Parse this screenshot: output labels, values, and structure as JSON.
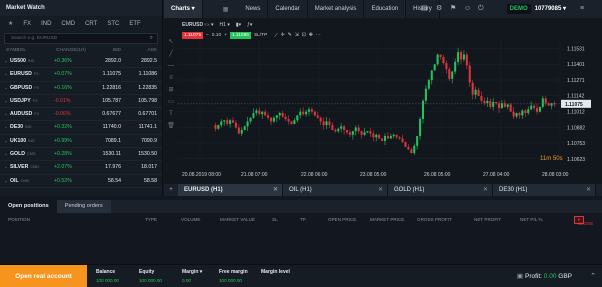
{
  "market_watch": {
    "title": "Market Watch",
    "tabs": [
      "FX",
      "IND",
      "CMD",
      "CRT",
      "STC",
      "ETF"
    ],
    "search_placeholder": "Search e.g. EURUSD",
    "columns": [
      "SYMBOL",
      "CHANGE(1H)",
      "BID",
      "ASK"
    ],
    "rows": [
      {
        "symbol": "US500",
        "type": "IND",
        "change": "+0.36%",
        "dir": "pos",
        "bid": "2892.0",
        "ask": "2892.5"
      },
      {
        "symbol": "EURUSD",
        "type": "FX",
        "change": "+0.07%",
        "dir": "pos",
        "bid": "1.11075",
        "ask": "1.11086"
      },
      {
        "symbol": "GBPUSD",
        "type": "FX",
        "change": "+0.16%",
        "dir": "pos",
        "bid": "1.22816",
        "ask": "1.22835"
      },
      {
        "symbol": "USDJPY",
        "type": "FX",
        "change": "-0.01%",
        "dir": "neg",
        "bid": "105.787",
        "ask": "105.798"
      },
      {
        "symbol": "AUDUSD",
        "type": "FX",
        "change": "-0.06%",
        "dir": "neg",
        "bid": "0.67677",
        "ask": "0.67701"
      },
      {
        "symbol": "DE30",
        "type": "IND",
        "change": "+0.32%",
        "dir": "pos",
        "bid": "11740.0",
        "ask": "11741.1"
      },
      {
        "symbol": "UK100",
        "type": "IND",
        "change": "+0.99%",
        "dir": "pos",
        "bid": "7089.1",
        "ask": "7090.9"
      },
      {
        "symbol": "GOLD",
        "type": "CMD",
        "change": "+0.28%",
        "dir": "pos",
        "bid": "1530.11",
        "ask": "1530.50"
      },
      {
        "symbol": "SILVER",
        "type": "CMD",
        "change": "+2.07%",
        "dir": "pos",
        "bid": "17.976",
        "ask": "18.017"
      },
      {
        "symbol": "OIL",
        "type": "CMD",
        "change": "+0.52%",
        "dir": "pos",
        "bid": "58.54",
        "ask": "58.58"
      }
    ]
  },
  "top_nav": {
    "charts_label": "Charts",
    "tabs": [
      "News",
      "Calendar",
      "Market analysis",
      "Education",
      "History"
    ],
    "account_badge": "DEMO",
    "account_id": "10779085"
  },
  "chart_toolbar": {
    "symbol": "EURUSD",
    "symbol_type": "FX",
    "timeframe": "H1",
    "sell_price": "1.11075",
    "volume": "0.10",
    "buy_price": "1.11086",
    "sl_tp": "SL/TP"
  },
  "chart_data": {
    "type": "candlestick",
    "symbol": "EURUSD",
    "timeframe": "H1",
    "current_price": "1.11075",
    "countdown": "11m 50s",
    "ylim": [
      1.1058,
      1.116
    ],
    "y_ticks": [
      "1.11531",
      "1.11401",
      "1.11271",
      "1.11142",
      "1.11012",
      "1.10882",
      "1.10753",
      "1.10623"
    ],
    "x_ticks": [
      "20.08.2019 08:00",
      "21.08 07:00",
      "22.08 06:00",
      "23.08 05:00",
      "26.08 05:00",
      "27.08 04:00",
      "28.08 03:00"
    ],
    "path": [
      1.109,
      1.1087,
      1.109,
      1.1093,
      1.1094,
      1.1091,
      1.1094,
      1.1092,
      1.1088,
      1.1083,
      1.1086,
      1.1089,
      1.1093,
      1.1096,
      1.11,
      1.1102,
      1.1099,
      1.1101,
      1.1098,
      1.1096,
      1.1093,
      1.1096,
      1.1098,
      1.11,
      1.1097,
      1.1095,
      1.1093,
      1.1091,
      1.1094,
      1.1098,
      1.1101,
      1.1099,
      1.1101,
      1.1103,
      1.1101,
      1.1098,
      1.1096,
      1.1093,
      1.109,
      1.1093,
      1.109,
      1.1086,
      1.1085,
      1.1087,
      1.1089,
      1.1086,
      1.1084,
      1.1082,
      1.1085,
      1.1088,
      1.1085,
      1.1082,
      1.1084,
      1.1085,
      1.1083,
      1.108,
      1.1082,
      1.1079,
      1.1077,
      1.1081,
      1.1079,
      1.1081,
      1.1082,
      1.108,
      1.1079,
      1.1076,
      1.1072,
      1.107,
      1.1067,
      1.1073,
      1.1081,
      1.1095,
      1.111,
      1.112,
      1.1127,
      1.1135,
      1.114,
      1.1148,
      1.1146,
      1.1141,
      1.1136,
      1.1128,
      1.1134,
      1.1142,
      1.115,
      1.1144,
      1.1148,
      1.1139,
      1.1125,
      1.1115,
      1.1119,
      1.1114,
      1.111,
      1.1108,
      1.111,
      1.1105,
      1.1109,
      1.1108,
      1.1104,
      1.1108,
      1.1105,
      1.1107,
      1.1101,
      1.1097,
      1.11,
      1.1098,
      1.1102,
      1.11,
      1.1103,
      1.1106,
      1.1104,
      1.1101,
      1.1105,
      1.1112,
      1.1108,
      1.1106,
      1.1108,
      1.1107
    ]
  },
  "chart_tabs": [
    {
      "label": "EURUSD (H1)",
      "active": true
    },
    {
      "label": "OIL (H1)",
      "active": false
    },
    {
      "label": "GOLD (H1)",
      "active": false
    },
    {
      "label": "DE30 (H1)",
      "active": false
    }
  ],
  "positions": {
    "tabs": [
      "Open positions",
      "Pending orders"
    ],
    "columns": [
      "POSITION",
      "TYPE",
      "VOLUME",
      "MARKET VALUE",
      "SL",
      "TP",
      "OPEN PRICE",
      "MARKET PRICE",
      "GROSS PROFIT",
      "NET PROFIT",
      "NET P/L %"
    ],
    "close_button": "CLOSE"
  },
  "bottom_bar": {
    "open_account": "Open real account",
    "stats": [
      {
        "label": "Balance",
        "value": "100 000.00"
      },
      {
        "label": "Equity",
        "value": "100 000.00"
      },
      {
        "label": "Margin",
        "value": "0.00"
      },
      {
        "label": "Free margin",
        "value": "100 000.00"
      },
      {
        "label": "Margin level",
        "value": ""
      }
    ],
    "profit_label": "Profit:",
    "profit_value": "0.00",
    "currency": "GBP"
  },
  "colors": {
    "up": "#24c35c",
    "down": "#e0343a",
    "accent": "#f7941d"
  }
}
